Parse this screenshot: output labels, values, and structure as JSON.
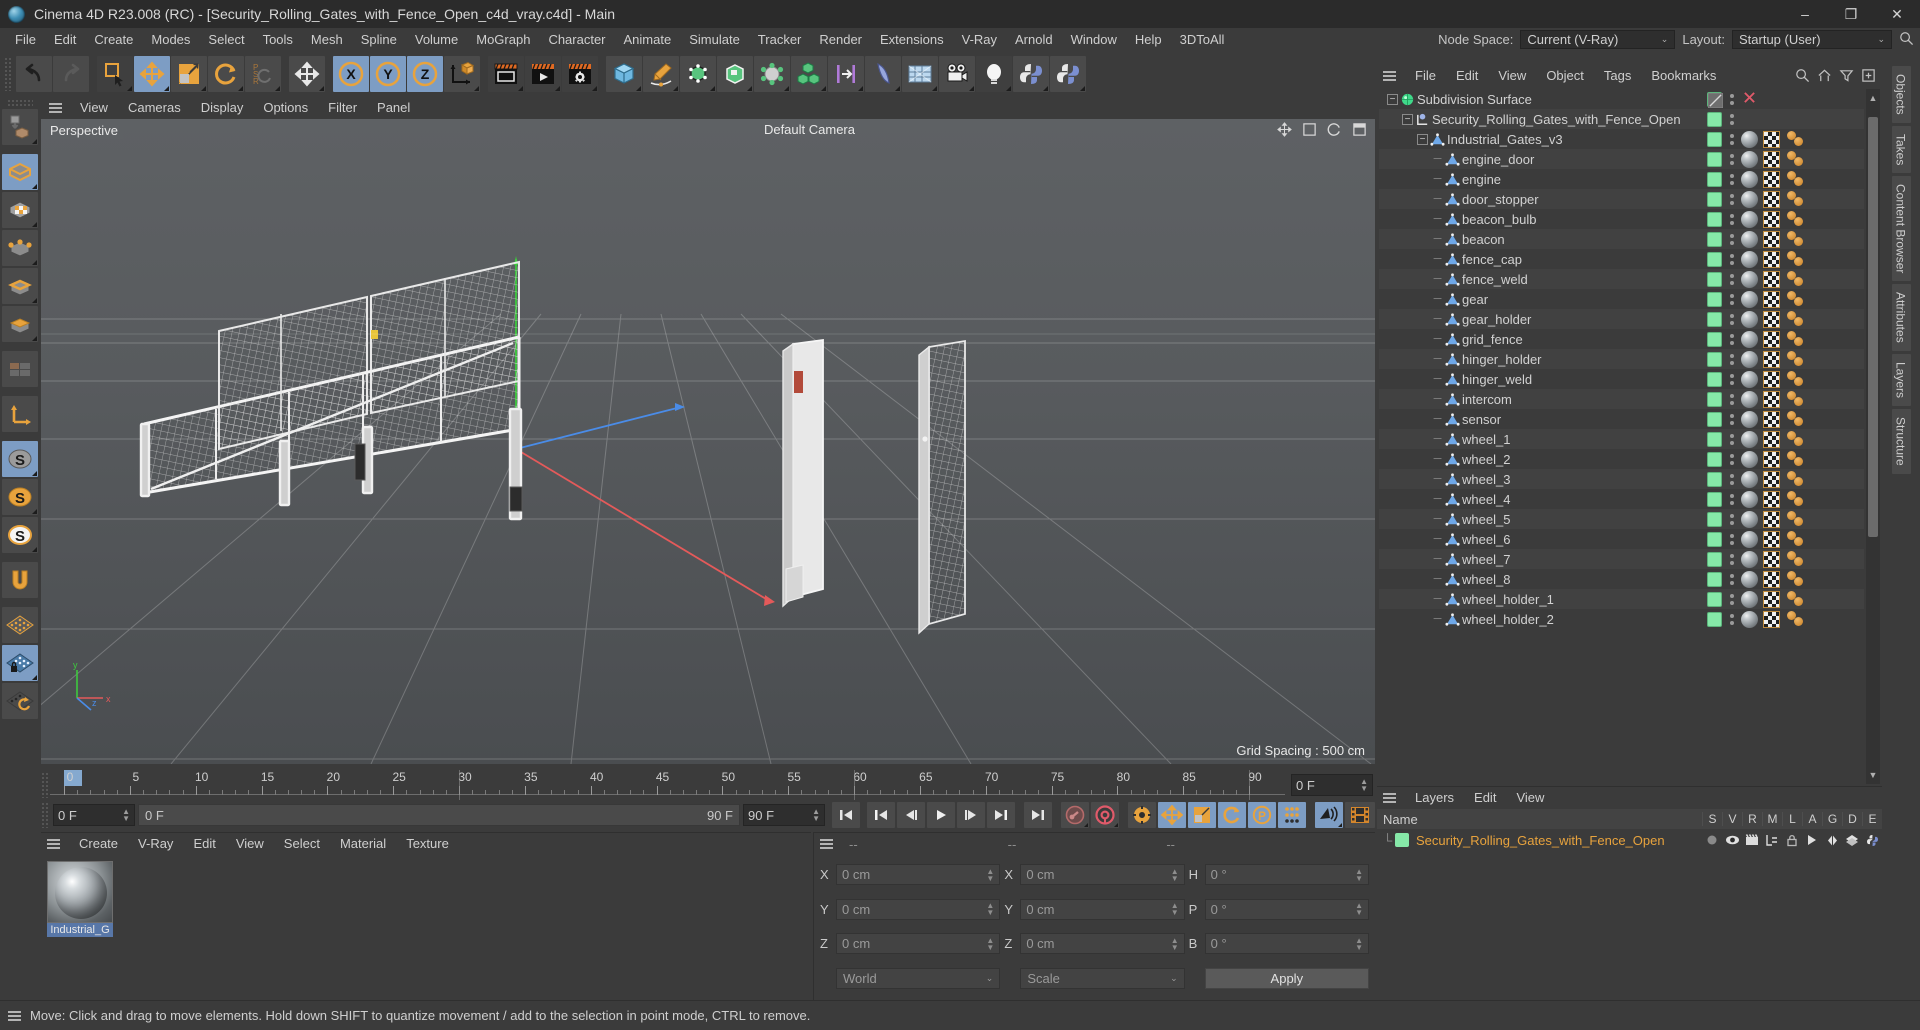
{
  "window": {
    "title": "Cinema 4D R23.008 (RC) - [Security_Rolling_Gates_with_Fence_Open_c4d_vray.c4d] - Main",
    "minimize": "–",
    "maximize": "❐",
    "close": "✕"
  },
  "menubar": {
    "items": [
      "File",
      "Edit",
      "Create",
      "Modes",
      "Select",
      "Tools",
      "Mesh",
      "Spline",
      "Volume",
      "MoGraph",
      "Character",
      "Animate",
      "Simulate",
      "Tracker",
      "Render",
      "Extensions",
      "V-Ray",
      "Arnold",
      "Window",
      "Help",
      "3DToAll"
    ],
    "node_space_label": "Node Space:",
    "node_space_value": "Current (V-Ray)",
    "layout_label": "Layout:",
    "layout_value": "Startup (User)",
    "caret": "⌄"
  },
  "toolbar": {
    "undo": "undo-icon",
    "redo": "redo-icon",
    "live_selection": "live-selection-icon",
    "move": "move-tool-icon",
    "scale": "scale-tool-icon",
    "rotate": "rotate-tool-icon",
    "psr": "psr-icon",
    "move_duplicate": "move-axis-icon",
    "axis_x": "X",
    "axis_y": "Y",
    "axis_z": "Z",
    "world_axis": "world-coordinate-icon",
    "render_view": "render-view-icon",
    "render_picture": "render-to-picture-icon",
    "render_settings": "render-settings-icon",
    "cube": "cube-primitive-icon",
    "spline_pen": "spline-pen-icon",
    "nurbs": "generator-icon",
    "scene_object": "scene-object-icon",
    "deformer": "deformer-icon",
    "mograph": "mograph-icon",
    "instance": "align-icon",
    "cloth": "cloth-icon",
    "environment": "environment-icon",
    "camera": "camera-icon",
    "light": "light-icon",
    "python1": "python-icon",
    "python2": "python-generator-icon"
  },
  "left_toolbar": {
    "items": [
      {
        "name": "make-editable-icon",
        "active": false
      },
      {
        "name": "model-mode-icon",
        "active": true
      },
      {
        "name": "texture-mode-icon",
        "active": false
      },
      {
        "name": "point-mode-icon",
        "active": false
      },
      {
        "name": "edge-mode-icon",
        "active": false
      },
      {
        "name": "polygon-mode-icon",
        "active": false
      },
      {
        "name": "viewport-solo-icon",
        "active": false
      },
      {
        "name": "axis-modify-icon",
        "active": false
      },
      {
        "name": "enable-snapping-icon",
        "active": true
      },
      {
        "name": "snap-settings-icon",
        "active": false
      },
      {
        "name": "quantize-icon",
        "active": false
      },
      {
        "name": "magnet-icon",
        "active": false
      },
      {
        "name": "workplane-icon",
        "active": false
      },
      {
        "name": "lock-workplane-icon",
        "active": true
      },
      {
        "name": "planar-workplane-icon",
        "active": false
      }
    ]
  },
  "viewport": {
    "menu": [
      "View",
      "Cameras",
      "Display",
      "Options",
      "Filter",
      "Panel"
    ],
    "label": "Perspective",
    "camera": "Default Camera",
    "grid_spacing": "Grid Spacing : 500 cm",
    "axis_labels": {
      "x": "x",
      "y": "y",
      "z": "z"
    }
  },
  "timeline": {
    "ticks": [
      0,
      5,
      10,
      15,
      20,
      25,
      30,
      35,
      40,
      45,
      50,
      55,
      60,
      65,
      70,
      75,
      80,
      85,
      90
    ],
    "current_frame": "0 F",
    "start_frame": "0 F",
    "preview_start": "0 F",
    "preview_end": "90 F",
    "end_frame": "90 F",
    "frame_field_right": "0 F"
  },
  "transport": {
    "buttons": [
      {
        "name": "go-to-start-button",
        "glyph": "❘◀"
      },
      {
        "name": "go-to-previous-keyframe-button",
        "glyph": "❘◀"
      },
      {
        "name": "step-back-button",
        "glyph": "◀❘"
      },
      {
        "name": "play-button",
        "glyph": "▶"
      },
      {
        "name": "step-forward-button",
        "glyph": "❘▶"
      },
      {
        "name": "go-to-next-keyframe-button",
        "glyph": "▶❘"
      },
      {
        "name": "go-to-end-button",
        "glyph": "▶❘"
      },
      {
        "name": "record-active-objects-button",
        "glyph": "•"
      },
      {
        "name": "autokeying-button",
        "glyph": "●"
      },
      {
        "name": "keyframe-selection-button",
        "glyph": "⚙"
      },
      {
        "name": "position-key-button",
        "glyph": "✛"
      },
      {
        "name": "scale-key-button",
        "glyph": "◢"
      },
      {
        "name": "rotation-key-button",
        "glyph": "↻"
      },
      {
        "name": "parameter-key-button",
        "glyph": "P"
      },
      {
        "name": "point-level-animation-button",
        "glyph": "⁙"
      },
      {
        "name": "sound-button",
        "glyph": "♪"
      },
      {
        "name": "film-button",
        "glyph": "⌗"
      }
    ]
  },
  "material_manager": {
    "menu": [
      "Create",
      "V-Ray",
      "Edit",
      "View",
      "Select",
      "Material",
      "Texture"
    ],
    "materials": [
      {
        "name": "Industrial_G",
        "selected": true
      }
    ]
  },
  "coordinates": {
    "header_dashes": [
      "--",
      "--",
      "--"
    ],
    "position": {
      "label_x": "X",
      "label_y": "Y",
      "label_z": "Z",
      "x": "0 cm",
      "y": "0 cm",
      "z": "0 cm"
    },
    "size": {
      "label_x": "X",
      "label_y": "Y",
      "label_z": "Z",
      "x": "0 cm",
      "y": "0 cm",
      "z": "0 cm"
    },
    "rotation": {
      "label_h": "H",
      "label_p": "P",
      "label_b": "B",
      "h": "0 °",
      "p": "0 °",
      "b": "0 °"
    },
    "system": "World",
    "mode": "Scale",
    "apply": "Apply",
    "caret": "⌄"
  },
  "object_manager": {
    "menu": [
      "File",
      "Edit",
      "View",
      "Object",
      "Tags",
      "Bookmarks"
    ],
    "icons": [
      "search-icon",
      "home-icon",
      "filter-icon",
      "add-icon"
    ],
    "rows": [
      {
        "label": "Subdivision Surface",
        "depth": 0,
        "type": "subdivision",
        "expandable": true,
        "tags": [
          "disabled-check",
          "dots",
          "delete"
        ]
      },
      {
        "label": "Security_Rolling_Gates_with_Fence_Open",
        "depth": 1,
        "type": "null",
        "expandable": true,
        "tags": [
          "green",
          "dots"
        ]
      },
      {
        "label": "Industrial_Gates_v3",
        "depth": 2,
        "type": "polygon",
        "expandable": true,
        "tags": [
          "green",
          "dots",
          "material",
          "checker",
          "balls"
        ]
      },
      {
        "label": "engine_door",
        "depth": 3,
        "type": "polygon",
        "expandable": false,
        "tags": [
          "green",
          "dots",
          "material",
          "checker",
          "balls"
        ]
      },
      {
        "label": "engine",
        "depth": 3,
        "type": "polygon",
        "expandable": false,
        "tags": [
          "green",
          "dots",
          "material",
          "checker",
          "balls"
        ]
      },
      {
        "label": "door_stopper",
        "depth": 3,
        "type": "polygon",
        "expandable": false,
        "tags": [
          "green",
          "dots",
          "material",
          "checker",
          "balls"
        ]
      },
      {
        "label": "beacon_bulb",
        "depth": 3,
        "type": "polygon",
        "expandable": false,
        "tags": [
          "green",
          "dots",
          "material",
          "checker",
          "balls"
        ]
      },
      {
        "label": "beacon",
        "depth": 3,
        "type": "polygon",
        "expandable": false,
        "tags": [
          "green",
          "dots",
          "material",
          "checker",
          "balls"
        ]
      },
      {
        "label": "fence_cap",
        "depth": 3,
        "type": "polygon",
        "expandable": false,
        "tags": [
          "green",
          "dots",
          "material",
          "checker",
          "balls"
        ]
      },
      {
        "label": "fence_weld",
        "depth": 3,
        "type": "polygon",
        "expandable": false,
        "tags": [
          "green",
          "dots",
          "material",
          "checker",
          "balls"
        ]
      },
      {
        "label": "gear",
        "depth": 3,
        "type": "polygon",
        "expandable": false,
        "tags": [
          "green",
          "dots",
          "material",
          "checker",
          "balls"
        ]
      },
      {
        "label": "gear_holder",
        "depth": 3,
        "type": "polygon",
        "expandable": false,
        "tags": [
          "green",
          "dots",
          "material",
          "checker",
          "balls"
        ]
      },
      {
        "label": "grid_fence",
        "depth": 3,
        "type": "polygon",
        "expandable": false,
        "tags": [
          "green",
          "dots",
          "material",
          "checker",
          "balls"
        ]
      },
      {
        "label": "hinger_holder",
        "depth": 3,
        "type": "polygon",
        "expandable": false,
        "tags": [
          "green",
          "dots",
          "material",
          "checker",
          "balls"
        ]
      },
      {
        "label": "hinger_weld",
        "depth": 3,
        "type": "polygon",
        "expandable": false,
        "tags": [
          "green",
          "dots",
          "material",
          "checker",
          "balls"
        ]
      },
      {
        "label": "intercom",
        "depth": 3,
        "type": "polygon",
        "expandable": false,
        "tags": [
          "green",
          "dots",
          "material",
          "checker",
          "balls"
        ]
      },
      {
        "label": "sensor",
        "depth": 3,
        "type": "polygon",
        "expandable": false,
        "tags": [
          "green",
          "dots",
          "material",
          "checker",
          "balls"
        ]
      },
      {
        "label": "wheel_1",
        "depth": 3,
        "type": "polygon",
        "expandable": false,
        "tags": [
          "green",
          "dots",
          "material",
          "checker",
          "balls"
        ]
      },
      {
        "label": "wheel_2",
        "depth": 3,
        "type": "polygon",
        "expandable": false,
        "tags": [
          "green",
          "dots",
          "material",
          "checker",
          "balls"
        ]
      },
      {
        "label": "wheel_3",
        "depth": 3,
        "type": "polygon",
        "expandable": false,
        "tags": [
          "green",
          "dots",
          "material",
          "checker",
          "balls"
        ]
      },
      {
        "label": "wheel_4",
        "depth": 3,
        "type": "polygon",
        "expandable": false,
        "tags": [
          "green",
          "dots",
          "material",
          "checker",
          "balls"
        ]
      },
      {
        "label": "wheel_5",
        "depth": 3,
        "type": "polygon",
        "expandable": false,
        "tags": [
          "green",
          "dots",
          "material",
          "checker",
          "balls"
        ]
      },
      {
        "label": "wheel_6",
        "depth": 3,
        "type": "polygon",
        "expandable": false,
        "tags": [
          "green",
          "dots",
          "material",
          "checker",
          "balls"
        ]
      },
      {
        "label": "wheel_7",
        "depth": 3,
        "type": "polygon",
        "expandable": false,
        "tags": [
          "green",
          "dots",
          "material",
          "checker",
          "balls"
        ]
      },
      {
        "label": "wheel_8",
        "depth": 3,
        "type": "polygon",
        "expandable": false,
        "tags": [
          "green",
          "dots",
          "material",
          "checker",
          "balls"
        ]
      },
      {
        "label": "wheel_holder_1",
        "depth": 3,
        "type": "polygon",
        "expandable": false,
        "tags": [
          "green",
          "dots",
          "material",
          "checker",
          "balls"
        ]
      },
      {
        "label": "wheel_holder_2",
        "depth": 3,
        "type": "polygon",
        "expandable": false,
        "tags": [
          "green",
          "dots",
          "material",
          "checker",
          "balls"
        ]
      }
    ]
  },
  "layers_manager": {
    "menu": [
      "Layers",
      "Edit",
      "View"
    ],
    "columns": [
      "S",
      "V",
      "R",
      "M",
      "L",
      "A",
      "G",
      "D",
      "E"
    ],
    "name_header": "Name",
    "rows": [
      {
        "label": "Security_Rolling_Gates_with_Fence_Open",
        "color": "#86e8a8"
      }
    ]
  },
  "right_tabs": [
    "Objects",
    "Takes",
    "Content Browser",
    "Attributes",
    "Layers",
    "Structure"
  ],
  "statusbar": {
    "message": "Move: Click and drag to move elements. Hold down SHIFT to quantize movement / add to the selection in point mode, CTRL to remove."
  },
  "colors": {
    "accent_orange": "#e8a33d",
    "tag_green": "#86e8a8",
    "active_blue": "#7d9dc4",
    "panel_bg": "#3b3b3b",
    "axis_x": "#e05a5a",
    "axis_y": "#5ad65a",
    "axis_z": "#5a8ae0"
  }
}
